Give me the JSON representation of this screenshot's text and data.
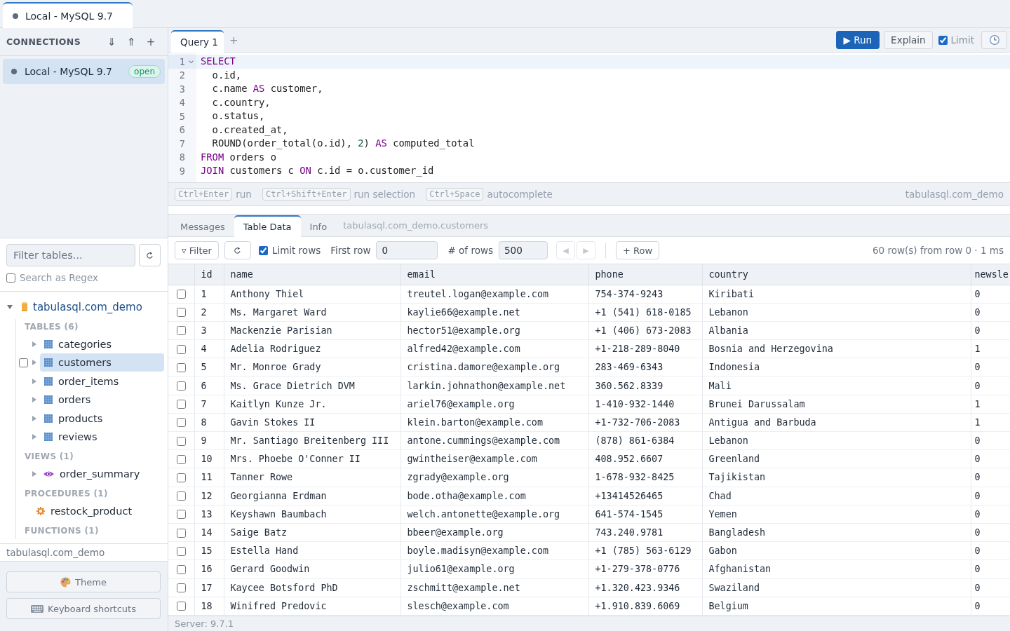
{
  "tabs": [
    {
      "label": "Local - MySQL 9.7",
      "selected": true
    }
  ],
  "sidebar": {
    "connections": {
      "title": "CONNECTIONS",
      "actions": [
        "⇓",
        "⇑",
        "+"
      ],
      "items": [
        {
          "label": "Local - MySQL 9.7",
          "badge": "open",
          "selected": true
        }
      ]
    },
    "filter": {
      "placeholder": "Filter tables...",
      "regex": {
        "label": "Search as Regex",
        "checked": false
      }
    },
    "tree": {
      "label": "tabulasql.com_demo",
      "expanded": true,
      "groups": [
        {
          "label": "TABLES (6)",
          "items": [
            {
              "kind": "table",
              "label": "categories",
              "expanded": false,
              "selected": false
            },
            {
              "kind": "table",
              "label": "customers",
              "expanded": false,
              "selected": true,
              "checkbox": {
                "checked": false
              }
            },
            {
              "kind": "table",
              "label": "order_items",
              "expanded": false,
              "selected": false
            },
            {
              "kind": "table",
              "label": "orders",
              "expanded": false,
              "selected": false
            },
            {
              "kind": "table",
              "label": "products",
              "expanded": false,
              "selected": false
            },
            {
              "kind": "table",
              "label": "reviews",
              "expanded": false,
              "selected": false
            }
          ]
        },
        {
          "label": "VIEWS (1)",
          "items": [
            {
              "kind": "view",
              "label": "order_summary",
              "expanded": false,
              "selected": false
            }
          ]
        },
        {
          "label": "PROCEDURES (1)",
          "items": [
            {
              "kind": "procedure",
              "label": "restock_product",
              "selected": false
            }
          ]
        },
        {
          "label": "FUNCTIONS (1)"
        }
      ]
    },
    "current_database": "tabulasql.com_demo",
    "buttons": [
      {
        "kind": "theme",
        "label": "Theme"
      },
      {
        "kind": "keyboard",
        "label": "Keyboard shortcuts"
      }
    ]
  },
  "editor": {
    "tabs": [
      {
        "label": "Query 1",
        "selected": true
      }
    ],
    "new_tab": "+",
    "toolbar": {
      "run": "▶ Run",
      "explain": "Explain",
      "limit": {
        "label": "Limit",
        "checked": true
      }
    },
    "lines": [
      {
        "number": "1",
        "active": true,
        "foldable": true,
        "tokens": [
          {
            "kind": "keyword",
            "text": "SELECT"
          }
        ]
      },
      {
        "number": "2",
        "active": false,
        "foldable": false,
        "tokens": [
          {
            "kind": "plain",
            "text": "  o.id,"
          }
        ]
      },
      {
        "number": "3",
        "active": false,
        "foldable": false,
        "tokens": [
          {
            "kind": "plain",
            "text": "  c.name "
          },
          {
            "kind": "keyword",
            "text": "AS"
          },
          {
            "kind": "plain",
            "text": " customer,"
          }
        ]
      },
      {
        "number": "4",
        "active": false,
        "foldable": false,
        "tokens": [
          {
            "kind": "plain",
            "text": "  c.country,"
          }
        ]
      },
      {
        "number": "5",
        "active": false,
        "foldable": false,
        "tokens": [
          {
            "kind": "plain",
            "text": "  o.status,"
          }
        ]
      },
      {
        "number": "6",
        "active": false,
        "foldable": false,
        "tokens": [
          {
            "kind": "plain",
            "text": "  o.created_at,"
          }
        ]
      },
      {
        "number": "7",
        "active": false,
        "foldable": false,
        "tokens": [
          {
            "kind": "plain",
            "text": "  ROUND(order_total(o.id), "
          },
          {
            "kind": "number",
            "text": "2"
          },
          {
            "kind": "plain",
            "text": ") "
          },
          {
            "kind": "keyword",
            "text": "AS"
          },
          {
            "kind": "plain",
            "text": " computed_total"
          }
        ]
      },
      {
        "number": "8",
        "active": false,
        "foldable": false,
        "tokens": [
          {
            "kind": "keyword",
            "text": "FROM"
          },
          {
            "kind": "plain",
            "text": " orders o"
          }
        ]
      },
      {
        "number": "9",
        "active": false,
        "foldable": false,
        "tokens": [
          {
            "kind": "keyword",
            "text": "JOIN"
          },
          {
            "kind": "plain",
            "text": " customers c "
          },
          {
            "kind": "keyword",
            "text": "ON"
          },
          {
            "kind": "plain",
            "text": " c.id = o.customer_id"
          }
        ]
      }
    ],
    "hints": [
      {
        "key": "Ctrl+Enter",
        "label": "run"
      },
      {
        "key": "Ctrl+Shift+Enter",
        "label": "run selection"
      },
      {
        "key": "Ctrl+Space",
        "label": "autocomplete"
      }
    ],
    "database": "tabulasql.com_demo"
  },
  "results": {
    "tabs": [
      {
        "label": "Messages",
        "selected": false
      },
      {
        "label": "Table Data",
        "selected": true
      },
      {
        "label": "Info",
        "selected": false
      }
    ],
    "context": "tabulasql.com_demo.customers",
    "toolbar": {
      "filter": "▿ Filter",
      "limit_rows": {
        "label": "Limit rows",
        "checked": true
      },
      "first_row": {
        "label": "First row",
        "value": "0"
      },
      "row_count": {
        "label": "# of rows",
        "value": "500"
      },
      "pager": [
        {
          "label": "◀",
          "disabled": true
        },
        {
          "label": "▶",
          "disabled": true
        }
      ],
      "add_row": "+ Row",
      "summary": "60 row(s) from row 0 · 1 ms"
    },
    "table": {
      "columns": [
        "id",
        "name",
        "email",
        "phone",
        "country",
        "newsle"
      ],
      "rows": [
        {
          "selected": false,
          "cells": [
            "1",
            "Anthony Thiel",
            "treutel.logan@example.com",
            "754-374-9243",
            "Kiribati",
            "0"
          ]
        },
        {
          "selected": false,
          "cells": [
            "2",
            "Ms. Margaret Ward",
            "kaylie66@example.net",
            "+1 (541) 618-0185",
            "Lebanon",
            "0"
          ]
        },
        {
          "selected": false,
          "cells": [
            "3",
            "Mackenzie Parisian",
            "hector51@example.org",
            "+1 (406) 673-2083",
            "Albania",
            "0"
          ]
        },
        {
          "selected": false,
          "cells": [
            "4",
            "Adelia Rodriguez",
            "alfred42@example.com",
            "+1-218-289-8040",
            "Bosnia and Herzegovina",
            "1"
          ]
        },
        {
          "selected": false,
          "cells": [
            "5",
            "Mr. Monroe Grady",
            "cristina.damore@example.org",
            "283-469-6343",
            "Indonesia",
            "0"
          ]
        },
        {
          "selected": false,
          "cells": [
            "6",
            "Ms. Grace Dietrich DVM",
            "larkin.johnathon@example.net",
            "360.562.8339",
            "Mali",
            "0"
          ]
        },
        {
          "selected": false,
          "cells": [
            "7",
            "Kaitlyn Kunze Jr.",
            "ariel76@example.org",
            "1-410-932-1440",
            "Brunei Darussalam",
            "1"
          ]
        },
        {
          "selected": false,
          "cells": [
            "8",
            "Gavin Stokes II",
            "klein.barton@example.com",
            "+1-732-706-2083",
            "Antigua and Barbuda",
            "1"
          ]
        },
        {
          "selected": false,
          "cells": [
            "9",
            "Mr. Santiago Breitenberg III",
            "antone.cummings@example.com",
            "(878) 861-6384",
            "Lebanon",
            "0"
          ]
        },
        {
          "selected": false,
          "cells": [
            "10",
            "Mrs. Phoebe O'Conner II",
            "gwintheiser@example.com",
            "408.952.6607",
            "Greenland",
            "0"
          ]
        },
        {
          "selected": false,
          "cells": [
            "11",
            "Tanner Rowe",
            "zgrady@example.org",
            "1-678-932-8425",
            "Tajikistan",
            "0"
          ]
        },
        {
          "selected": false,
          "cells": [
            "12",
            "Georgianna Erdman",
            "bode.otha@example.com",
            "+13414526465",
            "Chad",
            "0"
          ]
        },
        {
          "selected": false,
          "cells": [
            "13",
            "Keyshawn Baumbach",
            "welch.antonette@example.org",
            "641-574-1545",
            "Yemen",
            "0"
          ]
        },
        {
          "selected": false,
          "cells": [
            "14",
            "Saige Batz",
            "bbeer@example.org",
            "743.240.9781",
            "Bangladesh",
            "0"
          ]
        },
        {
          "selected": false,
          "cells": [
            "15",
            "Estella Hand",
            "boyle.madisyn@example.com",
            "+1 (785) 563-6129",
            "Gabon",
            "0"
          ]
        },
        {
          "selected": false,
          "cells": [
            "16",
            "Gerard Goodwin",
            "julio61@example.org",
            "+1-279-378-0776",
            "Afghanistan",
            "0"
          ]
        },
        {
          "selected": false,
          "cells": [
            "17",
            "Kaycee Botsford PhD",
            "zschmitt@example.net",
            "+1.320.423.9346",
            "Swaziland",
            "0"
          ]
        },
        {
          "selected": false,
          "cells": [
            "18",
            "Winifred Predovic",
            "slesch@example.com",
            "+1.910.839.6069",
            "Belgium",
            "0"
          ]
        }
      ]
    }
  },
  "status_bar": "Server: 9.7.1"
}
